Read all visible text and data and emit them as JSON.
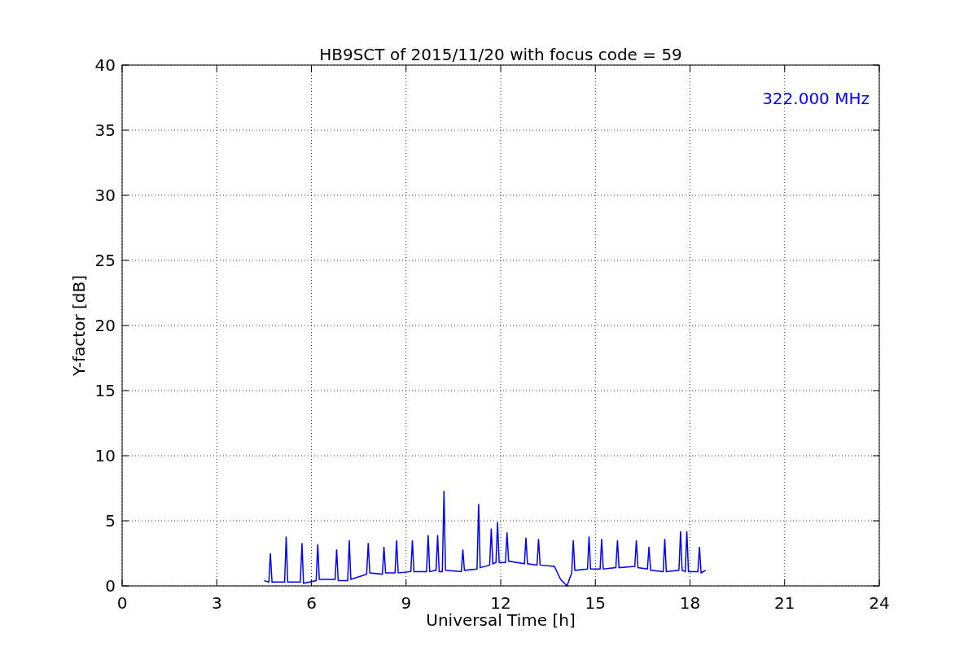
{
  "chart_data": {
    "type": "line",
    "title": "HB9SCT of 2015/11/20 with focus code = 59",
    "xlabel": "Universal Time [h]",
    "ylabel": "Y-factor [dB]",
    "grid": true,
    "xlim": [
      0,
      24
    ],
    "ylim": [
      0,
      40
    ],
    "xticks": [
      0,
      3,
      6,
      9,
      12,
      15,
      18,
      21,
      24
    ],
    "yticks": [
      0,
      5,
      10,
      15,
      20,
      25,
      30,
      35,
      40
    ],
    "x": [
      4.5,
      4.65,
      4.7,
      4.75,
      5.15,
      5.2,
      5.25,
      5.65,
      5.7,
      5.75,
      6.15,
      6.2,
      6.25,
      6.75,
      6.8,
      6.85,
      7.15,
      7.2,
      7.25,
      7.75,
      7.8,
      7.85,
      8.25,
      8.3,
      8.35,
      8.65,
      8.7,
      8.75,
      9.15,
      9.2,
      9.25,
      9.65,
      9.7,
      9.75,
      9.95,
      10.0,
      10.05,
      10.15,
      10.2,
      10.25,
      10.75,
      10.8,
      10.85,
      11.25,
      11.3,
      11.35,
      11.65,
      11.7,
      11.75,
      11.85,
      11.9,
      11.95,
      12.15,
      12.2,
      12.25,
      12.75,
      12.8,
      12.85,
      13.15,
      13.2,
      13.25,
      13.7,
      13.9,
      14.1,
      14.25,
      14.3,
      14.35,
      14.75,
      14.8,
      14.85,
      15.15,
      15.2,
      15.25,
      15.65,
      15.7,
      15.75,
      16.25,
      16.3,
      16.35,
      16.65,
      16.7,
      16.75,
      17.15,
      17.2,
      17.25,
      17.65,
      17.7,
      17.75,
      17.85,
      17.9,
      17.95,
      18.25,
      18.3,
      18.35,
      18.5
    ],
    "series": [
      {
        "name": "322.000 MHz",
        "color": "#0000ff",
        "values": [
          0.4,
          0.3,
          2.5,
          0.3,
          0.3,
          3.8,
          0.3,
          0.3,
          3.3,
          0.2,
          0.4,
          3.2,
          0.5,
          0.5,
          2.8,
          0.4,
          0.4,
          3.5,
          0.5,
          0.9,
          3.3,
          1.0,
          0.9,
          3.0,
          1.0,
          1.0,
          3.5,
          1.0,
          1.1,
          3.5,
          1.1,
          1.1,
          3.9,
          1.1,
          1.2,
          3.9,
          1.1,
          1.1,
          7.3,
          1.2,
          1.1,
          2.8,
          1.2,
          1.3,
          6.3,
          1.4,
          1.6,
          4.4,
          1.7,
          1.8,
          4.9,
          1.8,
          1.8,
          4.1,
          1.9,
          1.7,
          3.7,
          1.7,
          1.6,
          3.6,
          1.6,
          1.5,
          0.5,
          0.0,
          1.0,
          3.5,
          1.2,
          1.3,
          3.8,
          1.3,
          1.3,
          3.6,
          1.3,
          1.4,
          3.5,
          1.4,
          1.5,
          3.5,
          1.4,
          1.3,
          3.0,
          1.2,
          1.1,
          3.6,
          1.1,
          1.2,
          4.2,
          1.2,
          1.1,
          4.2,
          1.1,
          1.1,
          3.0,
          1.0,
          1.2
        ]
      }
    ]
  }
}
